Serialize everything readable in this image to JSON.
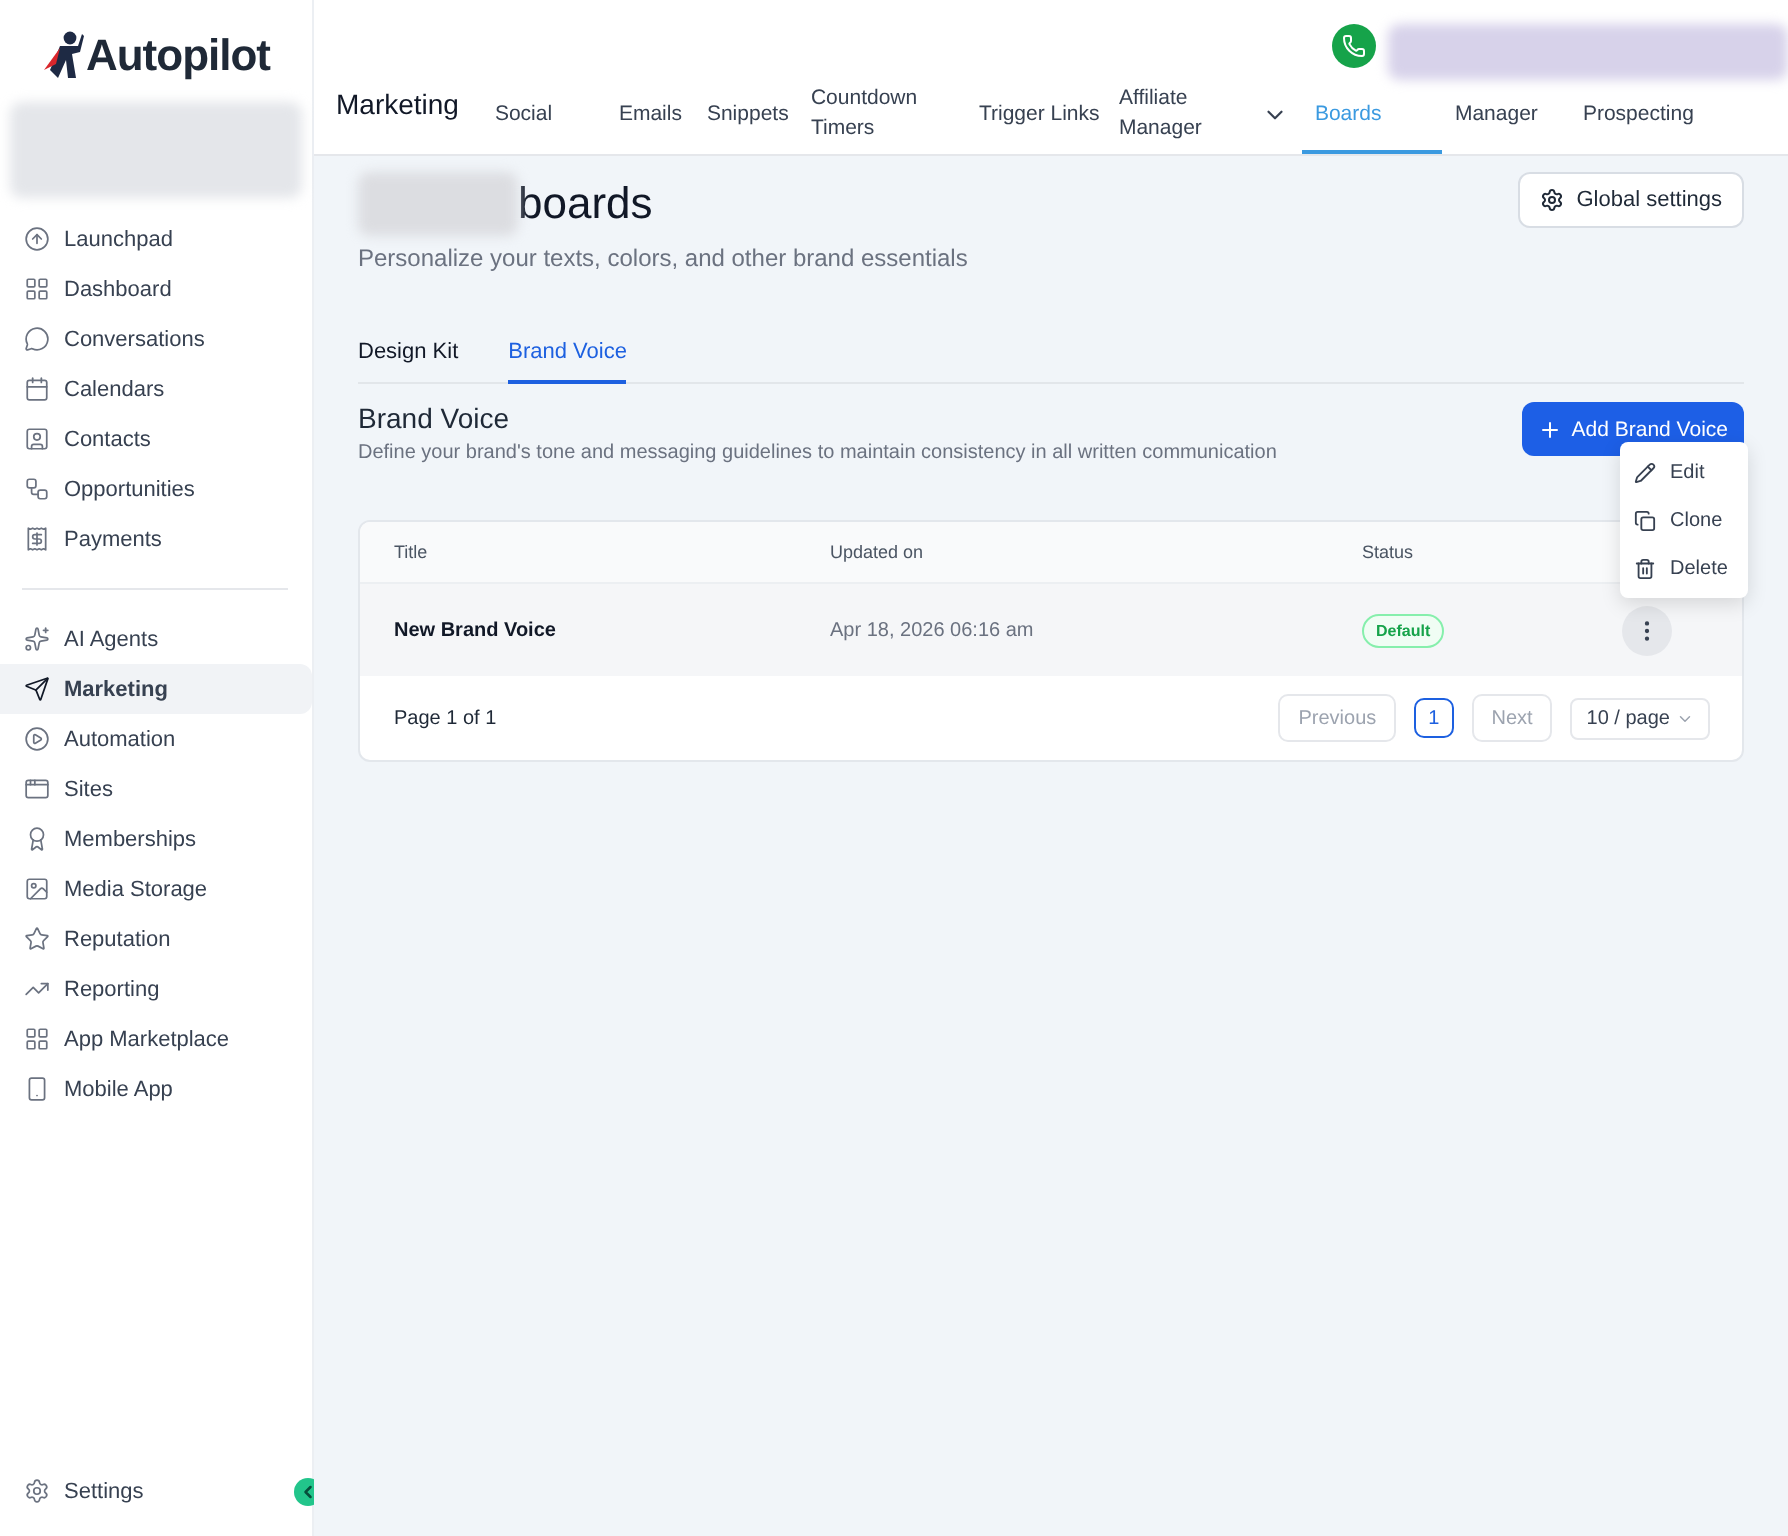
{
  "sidebar": {
    "logo": "Autopilot",
    "items": [
      {
        "label": "Launchpad",
        "selected": false
      },
      {
        "label": "Dashboard",
        "selected": false
      },
      {
        "label": "Conversations",
        "selected": false
      },
      {
        "label": "Calendars",
        "selected": false
      },
      {
        "label": "Contacts",
        "selected": false
      },
      {
        "label": "Opportunities",
        "selected": false
      },
      {
        "label": "Payments",
        "selected": false
      },
      {
        "label": "AI Agents",
        "selected": false
      },
      {
        "label": "Marketing",
        "selected": true
      },
      {
        "label": "Automation",
        "selected": false
      },
      {
        "label": "Sites",
        "selected": false
      },
      {
        "label": "Memberships",
        "selected": false
      },
      {
        "label": "Media Storage",
        "selected": false
      },
      {
        "label": "Reputation",
        "selected": false
      },
      {
        "label": "Reporting",
        "selected": false
      },
      {
        "label": "App Marketplace",
        "selected": false
      },
      {
        "label": "Mobile App",
        "selected": false
      }
    ],
    "settings": "Settings"
  },
  "header": {
    "title": "Marketing",
    "nav": [
      {
        "label": "Social",
        "selected": false
      },
      {
        "label": "Emails",
        "selected": false
      },
      {
        "label": "Snippets",
        "selected": false
      },
      {
        "label": "Countdown Timers",
        "selected": false
      },
      {
        "label": "Trigger Links",
        "selected": false
      },
      {
        "label": "Affiliate Manager",
        "selected": false
      },
      {
        "label": "Boards",
        "selected": true
      },
      {
        "label": "Manager",
        "selected": false
      },
      {
        "label": "Prospecting",
        "selected": false
      }
    ]
  },
  "page": {
    "heading": "boards",
    "subtitle": "Personalize your texts, colors, and other brand essentials",
    "global_settings": "Global settings",
    "tabs": [
      {
        "label": "Design Kit",
        "selected": false
      },
      {
        "label": "Brand Voice",
        "selected": true
      }
    ],
    "section_title": "Brand Voice",
    "section_description": "Define your brand's tone and messaging guidelines to maintain consistency in all written communication",
    "add_button": "Add Brand Voice",
    "table": {
      "columns": [
        "Title",
        "Updated on",
        "Status"
      ],
      "rows": [
        {
          "title": "New Brand Voice",
          "updated_on": "Apr 18, 2026 06:16 am",
          "status": "Default"
        }
      ]
    },
    "pagination": {
      "summary": "Page 1 of 1",
      "previous": {
        "label": "Previous",
        "disabled": true
      },
      "pages": [
        {
          "label": "1",
          "selected": true
        }
      ],
      "next": {
        "label": "Next",
        "disabled": true
      },
      "page_size": "10 / page"
    },
    "menu": [
      {
        "label": "Edit"
      },
      {
        "label": "Clone"
      },
      {
        "label": "Delete"
      }
    ]
  }
}
